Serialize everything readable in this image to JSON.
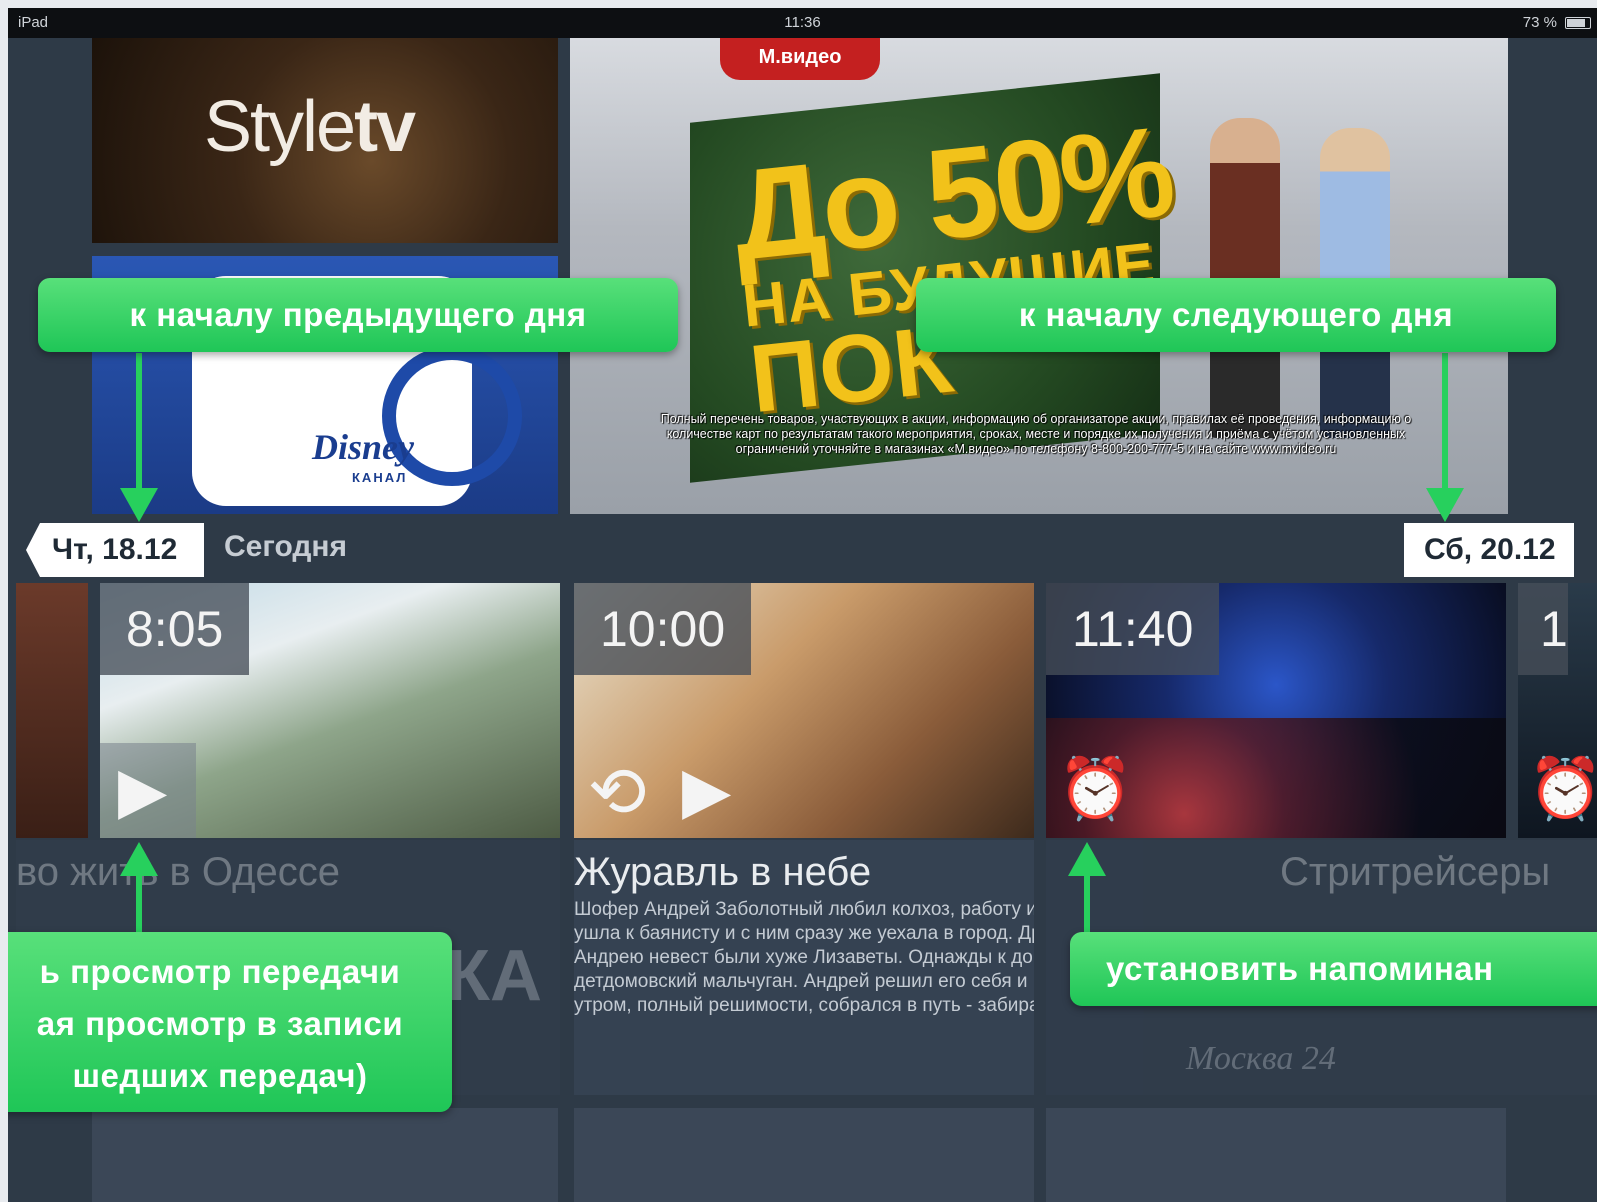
{
  "status_bar": {
    "device": "iPad",
    "time": "11:36",
    "battery": "73 %"
  },
  "channels": [
    {
      "name": "Styletv",
      "logo_regular": "Style",
      "logo_bold": "tv"
    },
    {
      "name": "Disney канал",
      "logo_brand": "Disney",
      "logo_sub": "КАНАЛ"
    }
  ],
  "ad": {
    "shop": "М.видео",
    "headline_1": "До 50%",
    "headline_2": "НА БУДУЩИЕ",
    "headline_3": "ПОК",
    "legal": "Полный перечень товаров, участвующих в акции, информацию об организаторе акции, правилах её проведения, информацию о количестве карт по результатам такого мероприятия, сроках, месте и порядке их получения и приёма с учётом установленных ограничений уточняйте в магазинах «М.видео» по телефону 8-800-200-777-5 и на сайте www.mvideo.ru"
  },
  "date_nav": {
    "prev": "Чт, 18.12",
    "today": "Сегодня",
    "next": "Сб, 20.12"
  },
  "programs": [
    {
      "time": "8:05",
      "action_icon": "play-icon",
      "title": "во жить в Одессе",
      "description": "",
      "extra": "КА"
    },
    {
      "time": "10:00",
      "action_icon": "replay-icon",
      "title": "Журавль в небе",
      "description": "Шофер Андрей Заболотный любил колхоз, работу и жену Лизу. А жена ушла к баянисту и с ним сразу же уехала в город. Друг стал приводить к Андрею невест были хуже Лизаветы. Однажды к дому шофе детдомовский мальчуган. Андрей решил его себя и помочь найти мать. А утром, полный решимости, собрался в путь - забирать Лизавету..."
    },
    {
      "time": "11:40",
      "action_icon": "alarm-icon",
      "title": "Стритрейсеры",
      "channel_logo": "Москва 24"
    },
    {
      "time": "1",
      "action_icon": "alarm-icon"
    }
  ],
  "callouts": {
    "prev_day": "к началу предыдущего дня",
    "next_day": "к началу следующего дня",
    "watch_line1": "ь просмотр передачи",
    "watch_line2": "ая просмотр в записи",
    "watch_line3": "шедших передач)",
    "reminder": "установить напоминан"
  },
  "colors": {
    "accent_green": "#27d05d",
    "background": "#2e3a47"
  }
}
